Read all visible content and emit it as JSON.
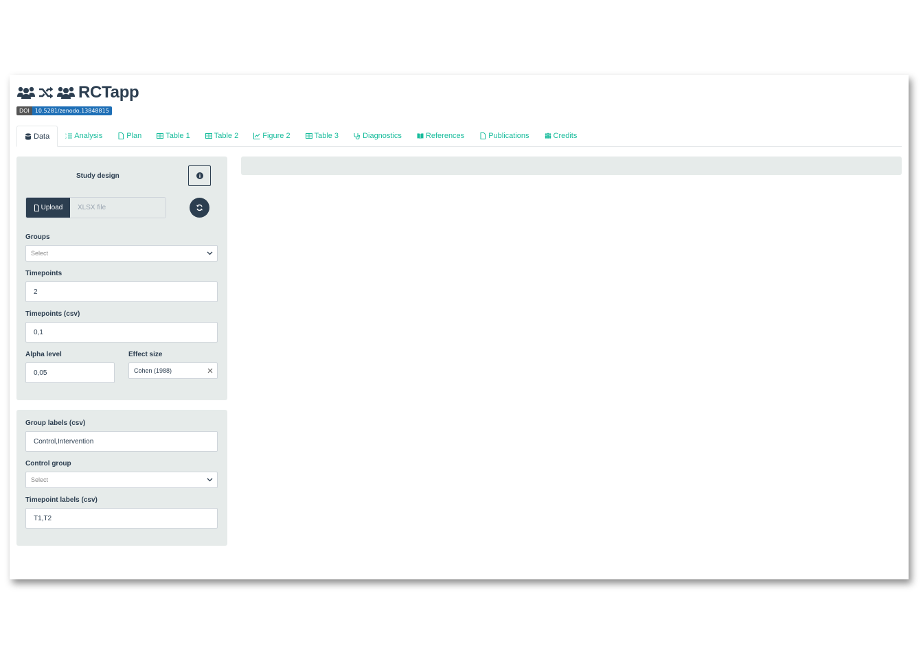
{
  "app": {
    "title": "RCTapp"
  },
  "doi": {
    "key": "DOI",
    "value": "10.5281/zenodo.13848815"
  },
  "tabs": [
    {
      "label": "Data",
      "icon": "database-icon",
      "active": true
    },
    {
      "label": "Analysis",
      "icon": "list-ol-icon"
    },
    {
      "label": "Plan",
      "icon": "file-icon"
    },
    {
      "label": "Table 1",
      "icon": "table-icon"
    },
    {
      "label": "Table 2",
      "icon": "table-icon"
    },
    {
      "label": "Figure 2",
      "icon": "line-chart-icon"
    },
    {
      "label": "Table 3",
      "icon": "table-icon"
    },
    {
      "label": "Diagnostics",
      "icon": "stethoscope-icon"
    },
    {
      "label": "References",
      "icon": "book-icon"
    },
    {
      "label": "Publications",
      "icon": "file-icon"
    },
    {
      "label": "Credits",
      "icon": "people-icon"
    }
  ],
  "study": {
    "heading": "Study design",
    "upload_label": "Upload",
    "file_placeholder": "XLSX file",
    "groups_label": "Groups",
    "groups_value": "Select",
    "timepoints_label": "Timepoints",
    "timepoints_value": "2",
    "timepoints_csv_label": "Timepoints (csv)",
    "timepoints_csv_value": "0,1",
    "alpha_label": "Alpha level",
    "alpha_value": "0,05",
    "effect_label": "Effect size",
    "effect_value": "Cohen (1988)"
  },
  "labels": {
    "group_labels_label": "Group labels (csv)",
    "group_labels_value": "Control,Intervention",
    "control_group_label": "Control group",
    "control_group_value": "Select",
    "timepoint_labels_label": "Timepoint labels (csv)",
    "timepoint_labels_value": "T1,T2"
  },
  "colors": {
    "accent": "#18bc9c",
    "primary": "#2c3e50",
    "panel": "#e6ebea",
    "doi": "#1e6fb6"
  }
}
